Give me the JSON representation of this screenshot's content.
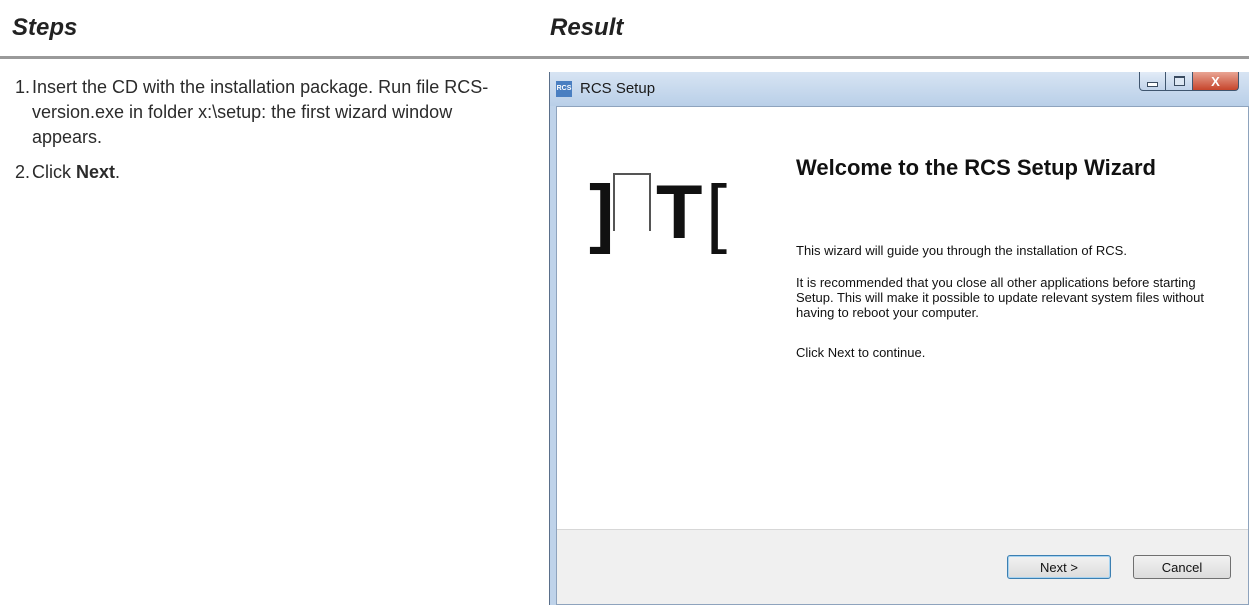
{
  "headers": {
    "steps": "Steps",
    "result": "Result"
  },
  "steps": [
    {
      "num": "1.",
      "text": "Insert the CD with the installation package. Run file RCS-version.exe in folder x:\\setup: the first wizard window appears."
    },
    {
      "num": "2.",
      "prefix": "Click ",
      "bold": "Next",
      "suffix": "."
    }
  ],
  "window": {
    "title": "RCS Setup",
    "app_icon_text": "RCS",
    "close_glyph": "X"
  },
  "wizard": {
    "logo_text": "]HT[",
    "heading": "Welcome to the RCS Setup Wizard",
    "paragraphs": [
      "This wizard will guide you through the installation of RCS.",
      "It is recommended that you close all other applications before starting Setup. This will make it possible to update relevant system files without having to reboot your computer.",
      "Click Next to continue."
    ],
    "next_label": "Next >",
    "cancel_label": "Cancel"
  }
}
